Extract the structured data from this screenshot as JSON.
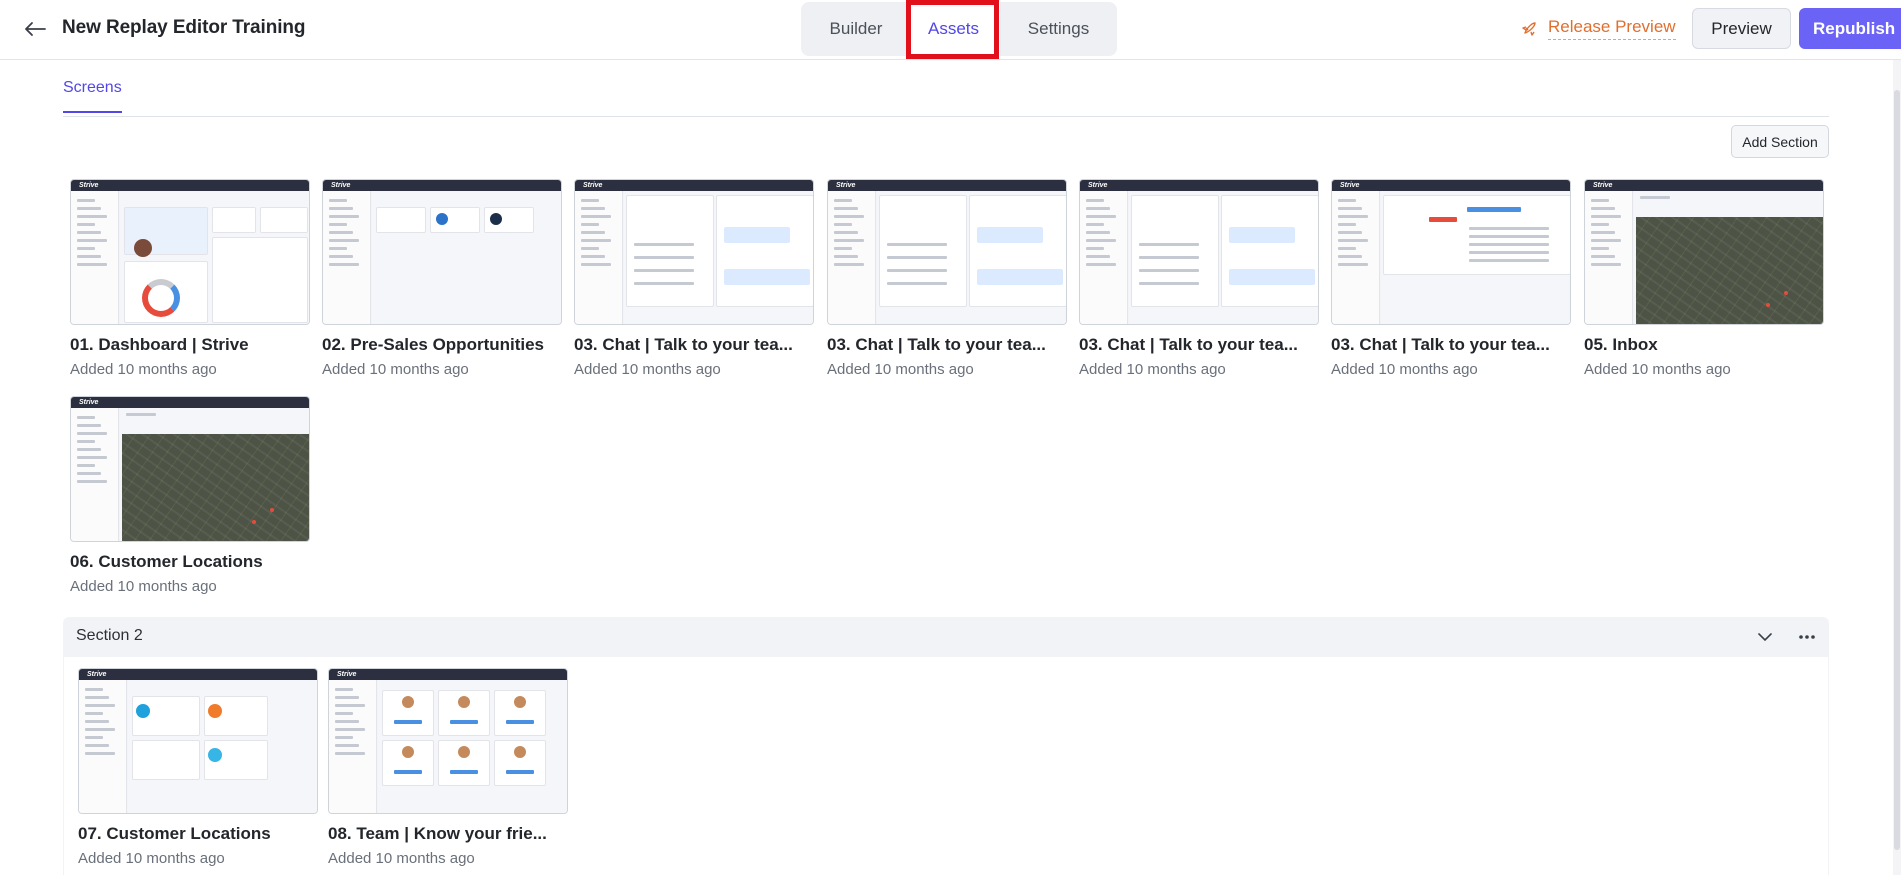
{
  "header": {
    "back_icon": "arrow-left-icon",
    "title": "New Replay Editor Training",
    "tabs": [
      {
        "label": "Builder",
        "active": false
      },
      {
        "label": "Assets",
        "active": true
      },
      {
        "label": "Settings",
        "active": false
      }
    ],
    "release_preview": {
      "label": "Release Preview",
      "icon": "rocket-icon",
      "color": "#df6f2f"
    },
    "preview_label": "Preview",
    "republish_label": "Republish",
    "accent": "#6b63f6",
    "highlight_color": "#e2101b"
  },
  "subtabs": {
    "active": "Screens",
    "items": [
      "Screens"
    ]
  },
  "add_section_label": "Add Section",
  "screens": [
    {
      "title": "01. Dashboard | Strive",
      "meta": "Added 10 months ago",
      "thumb": "dashboard"
    },
    {
      "title": "02. Pre-Sales Opportunities",
      "meta": "Added 10 months ago",
      "thumb": "presales"
    },
    {
      "title": "03. Chat | Talk to your tea...",
      "meta": "Added 10 months ago",
      "thumb": "chat"
    },
    {
      "title": "03. Chat | Talk to your tea...",
      "meta": "Added 10 months ago",
      "thumb": "chat"
    },
    {
      "title": "03. Chat | Talk to your tea...",
      "meta": "Added 10 months ago",
      "thumb": "chat"
    },
    {
      "title": "03. Chat | Talk to your tea...",
      "meta": "Added 10 months ago",
      "thumb": "inbox-list"
    },
    {
      "title": "05. Inbox",
      "meta": "Added 10 months ago",
      "thumb": "map"
    },
    {
      "title": "06. Customer Locations",
      "meta": "Added 10 months ago",
      "thumb": "map"
    }
  ],
  "section2": {
    "title": "Section 2",
    "collapse_icon": "chevron-down-icon",
    "more_icon": "more-horizontal-icon",
    "screens": [
      {
        "title": "07. Customer Locations",
        "meta": "Added 10 months ago",
        "thumb": "integrations"
      },
      {
        "title": "08. Team | Know your frie...",
        "meta": "Added 10 months ago",
        "thumb": "team"
      }
    ]
  },
  "thumb_logo": "Strive"
}
